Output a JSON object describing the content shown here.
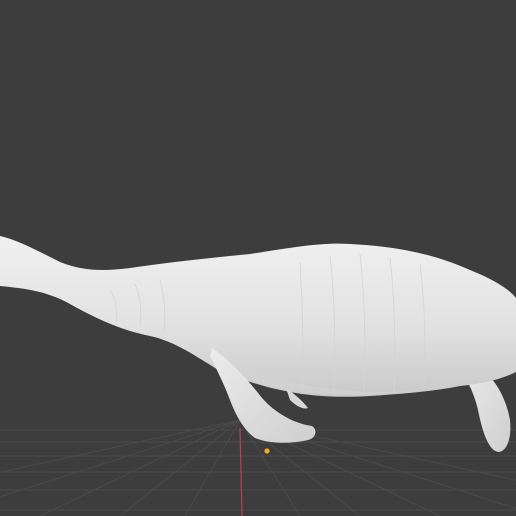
{
  "viewport": {
    "background": "#3d3d3d",
    "grid_color": "#4a4a4a",
    "z_axis_color": "#b8434f",
    "origin_marker_color": "#f5a623",
    "model_color": "#e6e6e6",
    "model_shadow_color": "#bdbdbd"
  },
  "scene": {
    "model": "plesiosaur-sculpt",
    "origin_icon": "origin-dot-icon"
  }
}
